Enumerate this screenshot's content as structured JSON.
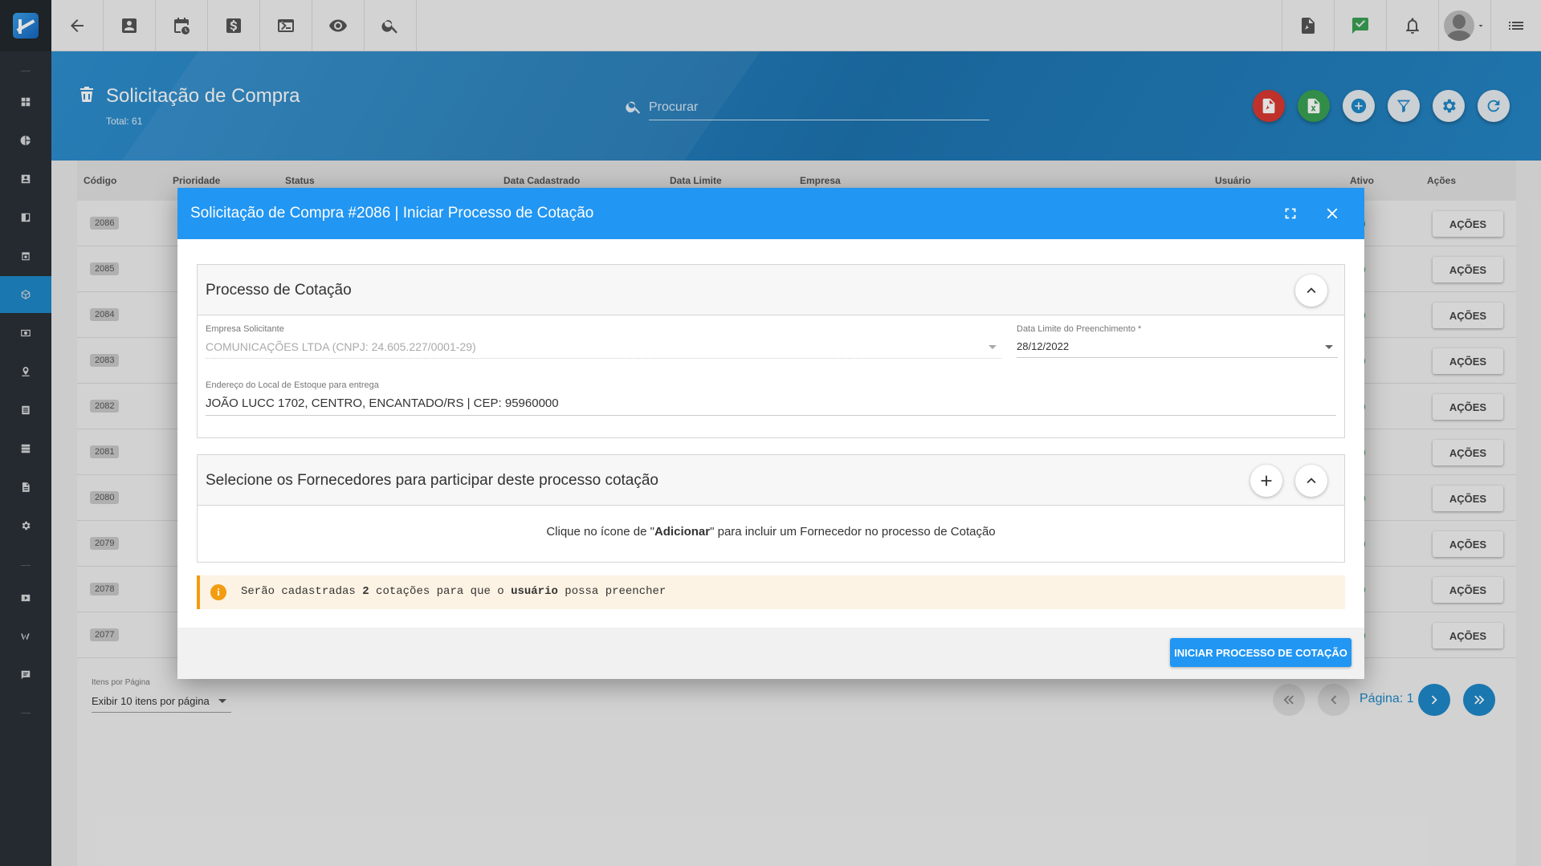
{
  "page": {
    "title": "Solicitação de Compra",
    "total": "Total: 61",
    "search_placeholder": "Procurar"
  },
  "table": {
    "columns": [
      "Código",
      "Prioridade",
      "Status",
      "Data Cadastrado",
      "Data Limite",
      "Empresa",
      "Usuário",
      "Ativo",
      "Ações"
    ],
    "rows": [
      {
        "code": "2086",
        "action": "AÇÕES"
      },
      {
        "code": "2085",
        "action": "AÇÕES"
      },
      {
        "code": "2084",
        "action": "AÇÕES"
      },
      {
        "code": "2083",
        "action": "AÇÕES"
      },
      {
        "code": "2082",
        "action": "AÇÕES"
      },
      {
        "code": "2081",
        "action": "AÇÕES"
      },
      {
        "code": "2080",
        "action": "AÇÕES"
      },
      {
        "code": "2079",
        "action": "AÇÕES"
      },
      {
        "code": "2078",
        "action": "AÇÕES"
      },
      {
        "code": "2077",
        "action": "AÇÕES"
      }
    ]
  },
  "pagination": {
    "per_page_label": "Itens por Página",
    "per_page_value": "Exibir 10 itens por página",
    "page_label": "Página: 1"
  },
  "modal": {
    "title": "Solicitação de Compra #2086 | Iniciar Processo de Cotação",
    "section1": {
      "title": "Processo de Cotação",
      "company_label": "Empresa Solicitante",
      "company_value": "COMUNICAÇÕES LTDA (CNPJ: 24.605.227/0001-29)",
      "deadline_label": "Data Limite do Preenchimento *",
      "deadline_value": "28/12/2022",
      "address_label": "Endereço do Local de Estoque para entrega",
      "address_value": "JOÃO LUCC 1702, CENTRO, ENCANTADO/RS | CEP: 95960000"
    },
    "section2": {
      "title": "Selecione os Fornecedores para participar deste processo cotação",
      "empty_pre": "Clique no ícone de \"",
      "empty_bold": "Adicionar",
      "empty_post": "\" para incluir um Fornecedor no processo de Cotação"
    },
    "alert": {
      "icon": "i",
      "t1": "Serão cadastradas ",
      "b1": "2",
      "t2": " cotações para que o ",
      "b2": "usuário",
      "t3": " possa preencher"
    },
    "primary_button": "INICIAR PROCESSO DE COTAÇÃO"
  },
  "colors": {
    "brand": "#2196f3",
    "header_band": "#1d74b0",
    "sidebar": "#2a3036",
    "pdf": "#d93a32",
    "excel": "#3aa152",
    "alert": "#f39c12"
  },
  "icons": {
    "toolbar": [
      "back-arrow-icon",
      "contacts-icon",
      "calendar-clock-icon",
      "dollar-icon",
      "terminal-icon",
      "eye-icon",
      "search-icon"
    ],
    "toolbar_right": [
      "pdf-file-icon",
      "check-message-icon",
      "bell-icon",
      "avatar",
      "menu-list-icon"
    ],
    "header_actions": [
      "pdf-icon",
      "excel-icon",
      "add-icon",
      "filter-icon",
      "settings-icon",
      "refresh-icon"
    ]
  }
}
